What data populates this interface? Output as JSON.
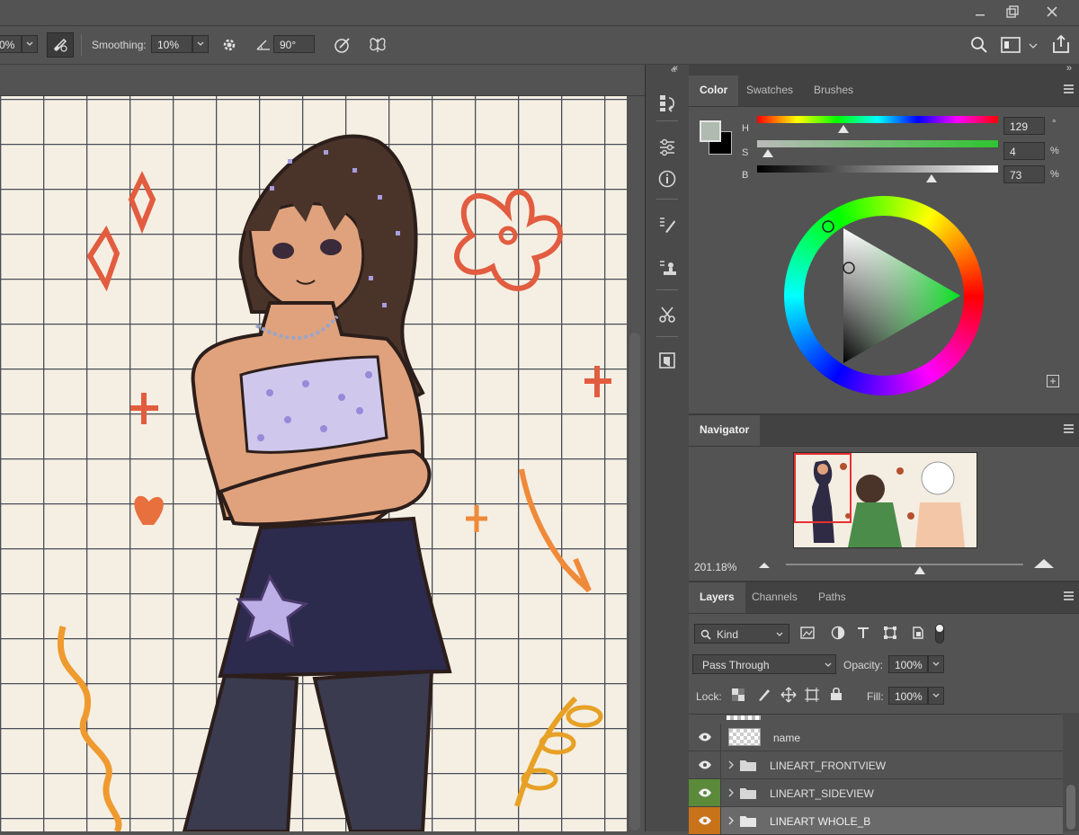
{
  "window": {
    "minimize_icon": "minimize-icon",
    "restore_icon": "restore-icon",
    "close_icon": "close-icon"
  },
  "options_bar": {
    "size_value": "0%",
    "smoothing_label": "Smoothing:",
    "smoothing_value": "10%",
    "angle_value": "90°"
  },
  "color_panel": {
    "tabs": [
      "Color",
      "Swatches",
      "Brushes"
    ],
    "h_label": "H",
    "s_label": "S",
    "b_label": "B",
    "h_value": "129",
    "s_value": "4",
    "b_value": "73",
    "h_unit": "°",
    "s_unit": "%",
    "b_unit": "%",
    "h_fraction": 0.358,
    "s_fraction": 0.04,
    "b_fraction": 0.73,
    "foreground_color": "#afbab0",
    "background_color": "#000000"
  },
  "navigator": {
    "tab": "Navigator",
    "zoom": "201.18%"
  },
  "layers_panel": {
    "tabs": [
      "Layers",
      "Channels",
      "Paths"
    ],
    "filter_kind": "Kind",
    "blend_mode": "Pass Through",
    "opacity_label": "Opacity:",
    "opacity_value": "100%",
    "lock_label": "Lock:",
    "fill_label": "Fill:",
    "fill_value": "100%",
    "layers": [
      {
        "name": "name",
        "type": "pixel",
        "eye_color": "#535353"
      },
      {
        "name": "LINEART_FRONTVIEW",
        "type": "group",
        "eye_color": "#535353"
      },
      {
        "name": "LINEART_SIDEVIEW",
        "type": "group",
        "eye_color": "#5a8a3a"
      },
      {
        "name": "LINEART WHOLE_B",
        "type": "group",
        "eye_color": "#c8731a"
      }
    ]
  }
}
